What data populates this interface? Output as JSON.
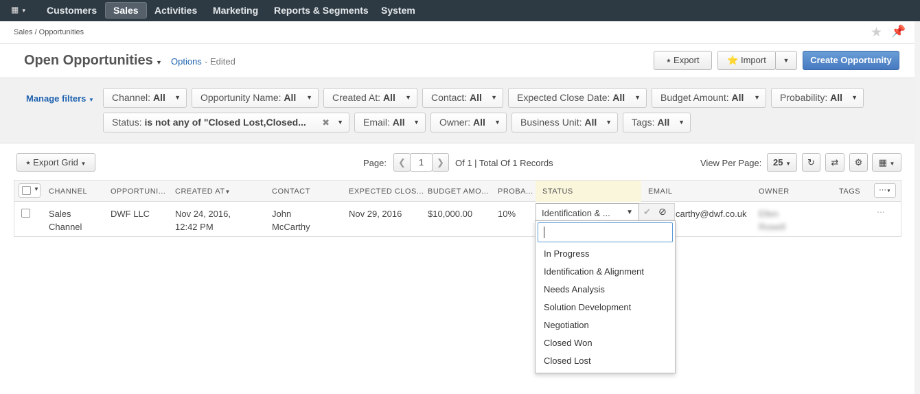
{
  "nav": {
    "items": [
      "Customers",
      "Sales",
      "Activities",
      "Marketing",
      "Reports & Segments",
      "System"
    ],
    "active": "Sales"
  },
  "breadcrumb": "Sales / Opportunities",
  "header": {
    "title": "Open Opportunities",
    "options_label": "Options",
    "edited_label": "- Edited",
    "export_label": "Export",
    "import_label": "Import",
    "create_label": "Create Opportunity"
  },
  "filters": {
    "manage_label": "Manage filters",
    "chips": [
      {
        "label": "Channel:",
        "value": "All"
      },
      {
        "label": "Opportunity Name:",
        "value": "All"
      },
      {
        "label": "Created At:",
        "value": "All"
      },
      {
        "label": "Contact:",
        "value": "All"
      },
      {
        "label": "Expected Close Date:",
        "value": "All"
      },
      {
        "label": "Budget Amount:",
        "value": "All"
      },
      {
        "label": "Probability:",
        "value": "All"
      },
      {
        "label": "Status:",
        "value": "is not any of \"Closed Lost,Closed..."
      },
      {
        "label": "Email:",
        "value": "All"
      },
      {
        "label": "Owner:",
        "value": "All"
      },
      {
        "label": "Business Unit:",
        "value": "All"
      },
      {
        "label": "Tags:",
        "value": "All"
      }
    ]
  },
  "toolbar": {
    "export_grid_label": "Export Grid",
    "page_label": "Page:",
    "page_value": "1",
    "page_info": "Of 1 | Total Of 1 Records",
    "view_per_page_label": "View Per Page:",
    "per_page_value": "25"
  },
  "grid": {
    "columns": [
      "CHANNEL",
      "OPPORTUNI...",
      "CREATED AT",
      "CONTACT",
      "EXPECTED CLOS...",
      "BUDGET AMO...",
      "PROBA...",
      "STATUS",
      "EMAIL",
      "OWNER",
      "TAGS"
    ],
    "row": {
      "channel_1": "Sales",
      "channel_2": "Channel",
      "opportunity": "DWF LLC",
      "created_1": "Nov 24, 2016,",
      "created_2": "12:42 PM",
      "contact_1": "John",
      "contact_2": "McCarthy",
      "expected_close": "Nov 29, 2016",
      "budget": "$10,000.00",
      "probability": "10%",
      "status_value": "Identification & ...",
      "email": "carthy@dwf.co.uk",
      "owner_1": "Ellen",
      "owner_2": "Rowell"
    }
  },
  "status_dropdown": {
    "search_value": "",
    "options": [
      "In Progress",
      "Identification & Alignment",
      "Needs Analysis",
      "Solution Development",
      "Negotiation",
      "Closed Won",
      "Closed Lost"
    ]
  }
}
